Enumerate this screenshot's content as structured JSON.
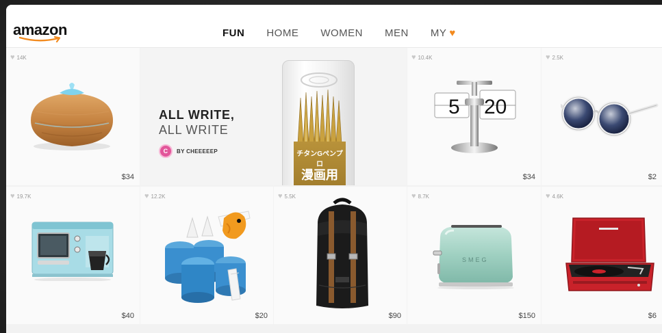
{
  "header": {
    "logo_text": "amazon",
    "nav": [
      {
        "label": "FUN",
        "active": true
      },
      {
        "label": "HOME",
        "active": false
      },
      {
        "label": "WOMEN",
        "active": false
      },
      {
        "label": "MEN",
        "active": false
      },
      {
        "label": "MY",
        "active": false,
        "icon": "heart-icon"
      }
    ]
  },
  "feature": {
    "title_line1": "ALL WRITE,",
    "title_line2": "ALL WRITE",
    "avatar_initial": "C",
    "byline": "BY CHEEEEEP",
    "package_text1": "チタンGペンプロ",
    "package_text2": "漫画用"
  },
  "products": [
    {
      "id": "diffuser",
      "likes": "14K",
      "price": "$34"
    },
    {
      "id": "flip-clock",
      "likes": "10.4K",
      "price": "$34"
    },
    {
      "id": "sunglasses",
      "likes": "2.5K",
      "price": "$2"
    },
    {
      "id": "breakfast-station",
      "likes": "19.7K",
      "price": "$40"
    },
    {
      "id": "popsicle-molds",
      "likes": "12.2K",
      "price": "$20"
    },
    {
      "id": "backpack",
      "likes": "5.5K",
      "price": "$90"
    },
    {
      "id": "toaster",
      "likes": "8.7K",
      "price": "$150"
    },
    {
      "id": "record-player",
      "likes": "4.6K",
      "price": "$6"
    }
  ],
  "colors": {
    "accent_orange": "#f28a1e",
    "avatar_pink": "#e2569a"
  }
}
